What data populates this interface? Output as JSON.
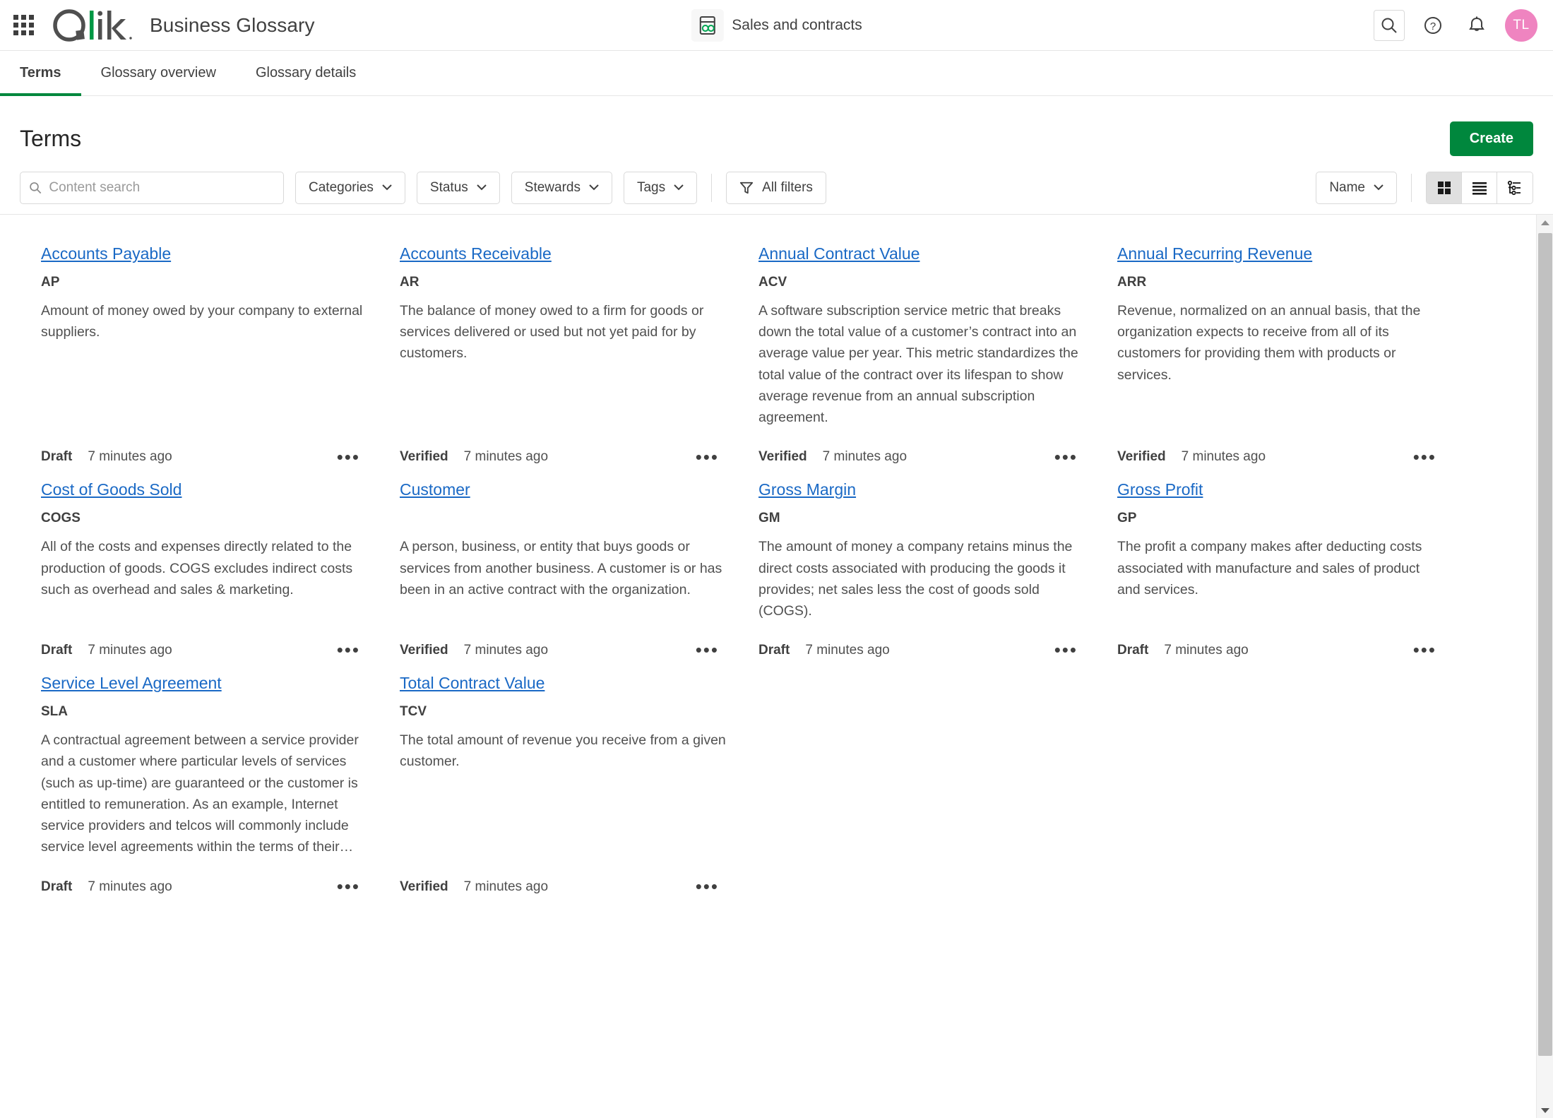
{
  "header": {
    "app_launcher": "app-launcher-grid",
    "logo_text": "Qlik",
    "brand_title": "Business Glossary",
    "space_name": "Sales and contracts",
    "avatar_initials": "TL"
  },
  "tabs": [
    {
      "label": "Terms",
      "active": true
    },
    {
      "label": "Glossary overview",
      "active": false
    },
    {
      "label": "Glossary details",
      "active": false
    }
  ],
  "page": {
    "title": "Terms",
    "create_label": "Create"
  },
  "toolbar": {
    "search_placeholder": "Content search",
    "search_value": "",
    "filters": [
      {
        "label": "Categories"
      },
      {
        "label": "Status"
      },
      {
        "label": "Stewards"
      },
      {
        "label": "Tags"
      }
    ],
    "all_filters_label": "All filters",
    "sort_label": "Name",
    "views": [
      {
        "name": "grid-view",
        "active": true
      },
      {
        "name": "list-view",
        "active": false
      },
      {
        "name": "tree-view",
        "active": false
      }
    ]
  },
  "terms": [
    {
      "title": "Accounts Payable",
      "abbreviation": "AP",
      "description": "Amount of money owed by your company to external suppliers.",
      "status": "Draft",
      "timestamp": "7 minutes ago"
    },
    {
      "title": "Accounts Receivable",
      "abbreviation": "AR",
      "description": "The balance of money owed to a firm for goods or services delivered or used but not yet paid for by customers.",
      "status": "Verified",
      "timestamp": "7 minutes ago"
    },
    {
      "title": "Annual Contract Value",
      "abbreviation": "ACV",
      "description": "A software subscription service metric that breaks down the total value of a customer’s contract into an average value per year. This metric standardizes the total value of the contract over its lifespan to show average revenue from an annual subscription agreement.",
      "status": "Verified",
      "timestamp": "7 minutes ago"
    },
    {
      "title": "Annual Recurring Revenue",
      "abbreviation": "ARR",
      "description": "Revenue, normalized on an annual basis, that the organization expects to receive from all of its customers for providing them with products or services.",
      "status": "Verified",
      "timestamp": "7 minutes ago"
    },
    {
      "title": "Cost of Goods Sold",
      "abbreviation": "COGS",
      "description": "All of the costs and expenses directly related to the production of goods. COGS excludes indirect costs such as overhead and sales & marketing.",
      "status": "Draft",
      "timestamp": "7 minutes ago"
    },
    {
      "title": "Customer",
      "abbreviation": "",
      "description": "A person, business, or entity that buys goods or services from another business. A customer is or has been in an active contract with the organization.",
      "status": "Verified",
      "timestamp": "7 minutes ago"
    },
    {
      "title": "Gross Margin",
      "abbreviation": "GM",
      "description": "The amount of money a company retains minus the direct costs associated with producing the goods it provides; net sales less the cost of goods sold (COGS).",
      "status": "Draft",
      "timestamp": "7 minutes ago"
    },
    {
      "title": "Gross Profit",
      "abbreviation": "GP",
      "description": "The profit a company makes after deducting costs associated with manufacture and sales of product and services.",
      "status": "Draft",
      "timestamp": "7 minutes ago"
    },
    {
      "title": "Service Level Agreement",
      "abbreviation": "SLA",
      "description": "A contractual agreement between a service provider and a customer where particular levels of services (such as up-time) are guaranteed or the customer is entitled to remuneration. As an example, Internet service providers and telcos will commonly include service level agreements within the terms of their…",
      "status": "Draft",
      "timestamp": "7 minutes ago"
    },
    {
      "title": "Total Contract Value",
      "abbreviation": "TCV",
      "description": "The total amount of revenue you receive from a given customer.",
      "status": "Verified",
      "timestamp": "7 minutes ago"
    }
  ],
  "colors": {
    "accent_green": "#00873d",
    "link_blue": "#1a69c5",
    "avatar_pink": "#ef84c0",
    "text": "#404040"
  }
}
